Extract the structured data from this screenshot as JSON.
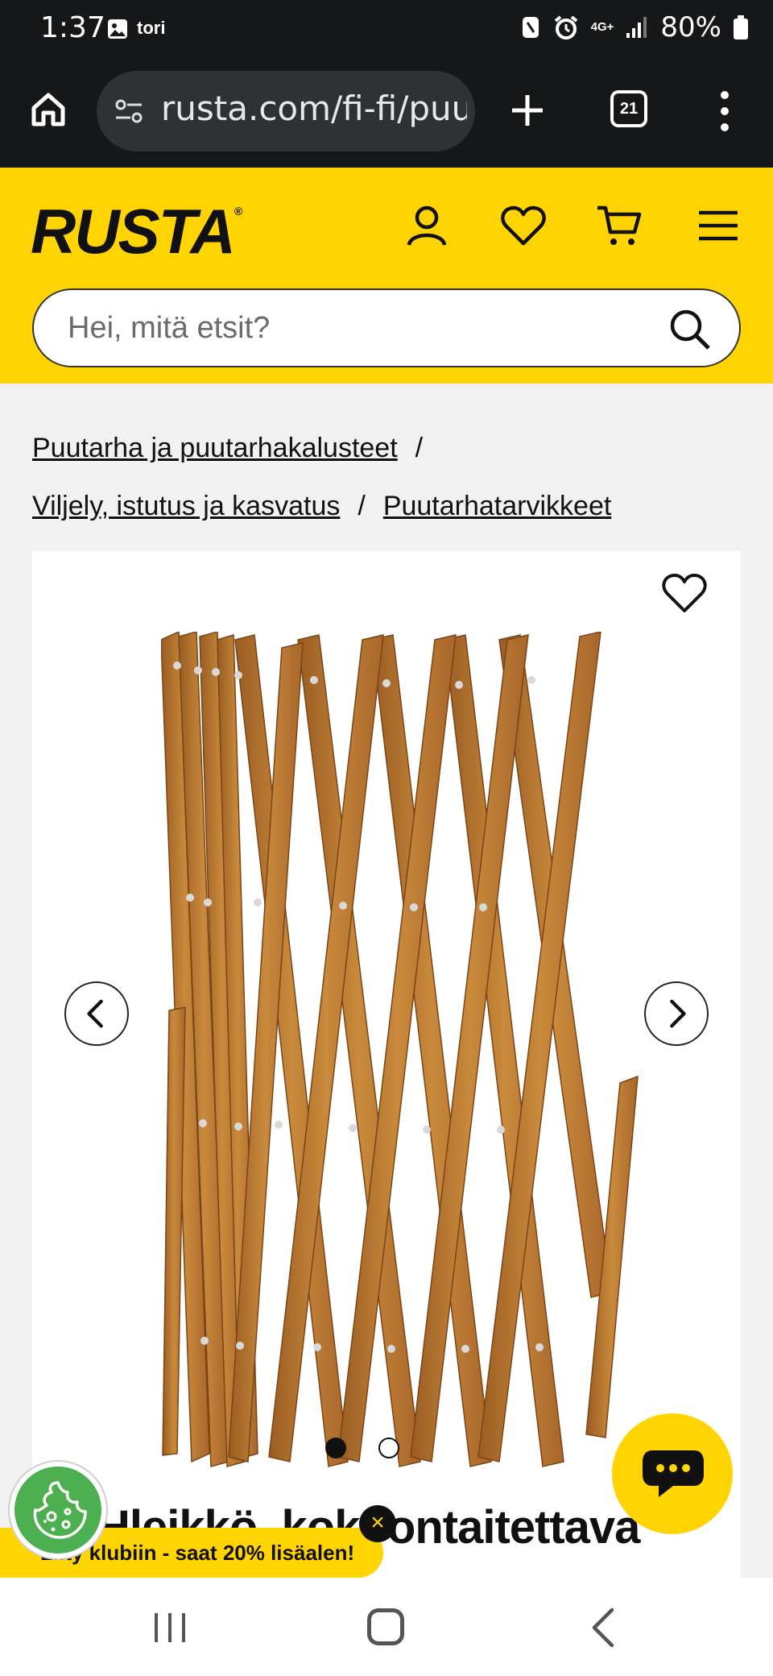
{
  "status_bar": {
    "time": "1:37",
    "notification_label": "tori",
    "battery": "80%",
    "network": "4G+"
  },
  "browser": {
    "url": "rusta.com/fi-fi/puu",
    "tab_count": "21"
  },
  "header": {
    "logo": "RUSTA",
    "logo_mark": "®",
    "search_placeholder": "Hei, mitä etsit?",
    "brand_color": "#ffd400"
  },
  "breadcrumb": {
    "items": [
      "Puutarha ja puutarhakalusteet",
      "Viljely, istutus ja kasvatus",
      "Puutarhatarvikkeet"
    ],
    "separator": "/"
  },
  "product": {
    "title": "Hleikkö, kokoontaitettava",
    "image_count": 2,
    "active_image": 1
  },
  "promo": {
    "text": "Liity klubiin - saat 20% lisäalen!",
    "close_label": "×"
  },
  "icons": {
    "account": "user-icon",
    "wishlist": "heart-icon",
    "cart": "cart-icon",
    "menu": "hamburger-icon",
    "search": "search-icon",
    "chat": "chat-icon",
    "cookie": "cookie-icon"
  }
}
